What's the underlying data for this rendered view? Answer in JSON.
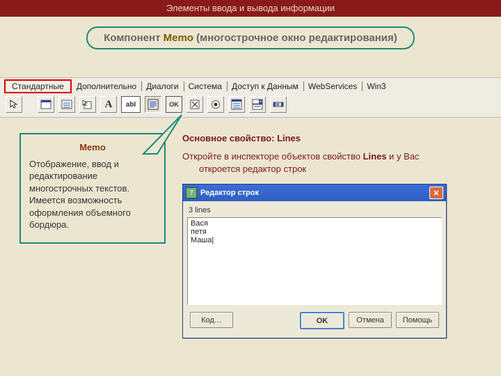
{
  "header": {
    "title": "Элементы ввода и вывода информации"
  },
  "pill": {
    "component": "Компонент",
    "name": "Memo",
    "rest": "(многострочное окно редактирования)"
  },
  "palette": {
    "tabs": {
      "t0": "Стандартные",
      "t1": "Дополнительно",
      "t2": "Диалоги",
      "t3": "Система",
      "t4": "Доступ к Данным",
      "t5": "WebServices",
      "t6": "Win3"
    },
    "iconA": "A",
    "iconAbl": "abI",
    "iconOK": "OK"
  },
  "callout": {
    "title": "Memo",
    "body": "Отображение, ввод и редактирование многострочных текстов. Имеется возможность оформления объемного бордюра."
  },
  "right": {
    "prop_label": "Основное свойство:",
    "prop_value": "Lines",
    "hint_a": "Откройте в инспекторе объектов свойство ",
    "hint_bold": "Lines",
    "hint_b": " и у Вас",
    "hint_c": "откроется редактор строк"
  },
  "dialog": {
    "title": "Редактор строк",
    "count": "3 lines",
    "line1": "Вася",
    "line2": "петя",
    "line3": "Маша",
    "btn_code": "Код…",
    "btn_ok": "OK",
    "btn_cancel": "Отмена",
    "btn_help": "Помощь"
  }
}
